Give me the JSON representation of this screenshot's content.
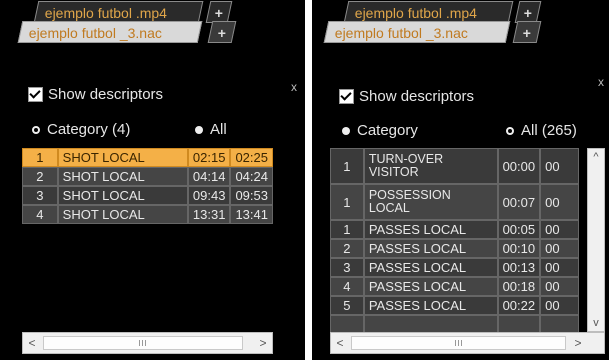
{
  "left": {
    "tab_back": "ejemplo futbol .mp4",
    "tab_front": "ejemplo futbol _3.nac",
    "plus": "+",
    "close": "x",
    "show_descriptors": "Show descriptors",
    "radio_category": "Category (4)",
    "radio_all": "All",
    "rows": [
      {
        "n": "1",
        "name": "SHOT LOCAL",
        "t1": "02:15",
        "t2": "02:25"
      },
      {
        "n": "2",
        "name": "SHOT LOCAL",
        "t1": "04:14",
        "t2": "04:24"
      },
      {
        "n": "3",
        "name": "SHOT LOCAL",
        "t1": "09:43",
        "t2": "09:53"
      },
      {
        "n": "4",
        "name": "SHOT LOCAL",
        "t1": "13:31",
        "t2": "13:41"
      }
    ],
    "scroll_left": "<",
    "scroll_right": ">"
  },
  "right": {
    "tab_back": "ejemplo futbol .mp4",
    "tab_front": "ejemplo futbol _3.nac",
    "plus": "+",
    "close": "x",
    "show_descriptors": "Show descriptors",
    "radio_category": "Category",
    "radio_all": "All (265)",
    "rows": [
      {
        "n": "1",
        "name": "TURN-OVER VISITOR",
        "t1": "00:00",
        "t2": "00"
      },
      {
        "n": "1",
        "name": "POSSESSION LOCAL",
        "t1": "00:07",
        "t2": "00"
      },
      {
        "n": "1",
        "name": "PASSES LOCAL",
        "t1": "00:05",
        "t2": "00"
      },
      {
        "n": "2",
        "name": "PASSES LOCAL",
        "t1": "00:10",
        "t2": "00"
      },
      {
        "n": "3",
        "name": "PASSES LOCAL",
        "t1": "00:13",
        "t2": "00"
      },
      {
        "n": "4",
        "name": "PASSES LOCAL",
        "t1": "00:18",
        "t2": "00"
      },
      {
        "n": "5",
        "name": "PASSES LOCAL",
        "t1": "00:22",
        "t2": "00"
      }
    ],
    "scroll_left": "<",
    "scroll_right": ">",
    "scroll_up": "^",
    "scroll_down": "v"
  }
}
